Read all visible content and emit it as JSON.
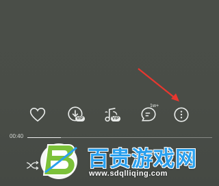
{
  "player": {
    "actions": [
      {
        "name": "like-button",
        "icon": "heart-icon",
        "badge": ""
      },
      {
        "name": "download-button",
        "icon": "download-icon",
        "badge": "VIP"
      },
      {
        "name": "sound-effect-button",
        "icon": "sound-effect-icon",
        "badge": "VIP"
      },
      {
        "name": "comments-button",
        "icon": "comment-icon",
        "badge": "1w+"
      },
      {
        "name": "more-button",
        "icon": "more-vertical-icon",
        "badge": ""
      }
    ],
    "progress": {
      "elapsed": "00:40",
      "fraction": 0.18
    },
    "annotation_color": "#e8372f"
  },
  "watermark": {
    "title": "百贵游戏网",
    "url": "www.sdqlliqing.com",
    "brand_color": "#2aa0ee",
    "logo_color": "#7cc13a"
  }
}
